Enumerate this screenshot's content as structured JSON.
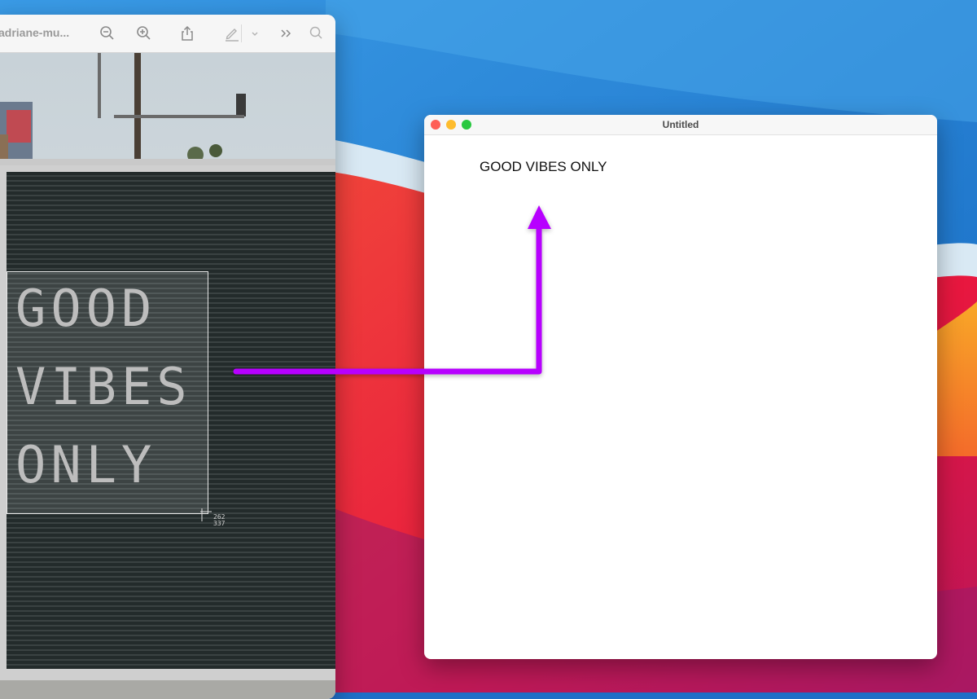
{
  "preview": {
    "title": "adriane-mu...",
    "toolbar_icons": [
      "zoom-out-icon",
      "zoom-in-icon",
      "share-icon",
      "markup-pen-icon",
      "chevron-down-icon",
      "double-chevron-icon",
      "search-icon"
    ],
    "sign_lines": [
      "GOOD",
      "VIBES",
      "ONLY"
    ],
    "selection_size": [
      "262",
      "337"
    ]
  },
  "editor": {
    "title": "Untitled",
    "content": "GOOD VIBES ONLY"
  },
  "colors": {
    "arrow": "#b700ff",
    "traffic_close": "#fe5f57",
    "traffic_min": "#febc2e",
    "traffic_max": "#28c840"
  }
}
